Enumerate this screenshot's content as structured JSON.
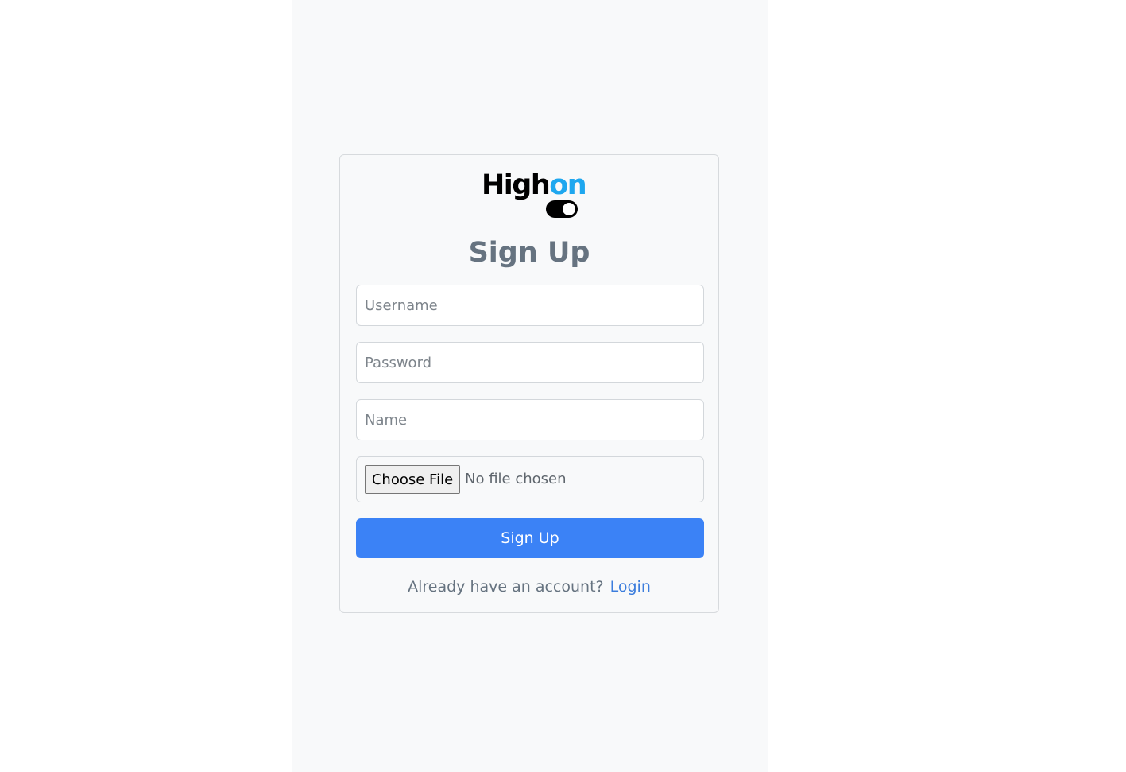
{
  "logo": {
    "part1": "High",
    "part2": "on",
    "colors": {
      "dark": "#000000",
      "accent": "#1ea7ef"
    }
  },
  "form": {
    "title": "Sign Up",
    "username_placeholder": "Username",
    "password_placeholder": "Password",
    "name_placeholder": "Name",
    "file_button_label": "Choose File",
    "file_status": "No file chosen",
    "submit_label": "Sign Up"
  },
  "footer": {
    "prompt": "Already have an account?",
    "login_label": "Login"
  },
  "colors": {
    "primary": "#3b82f6",
    "link": "#3b7ddd",
    "title_text": "#667380"
  }
}
